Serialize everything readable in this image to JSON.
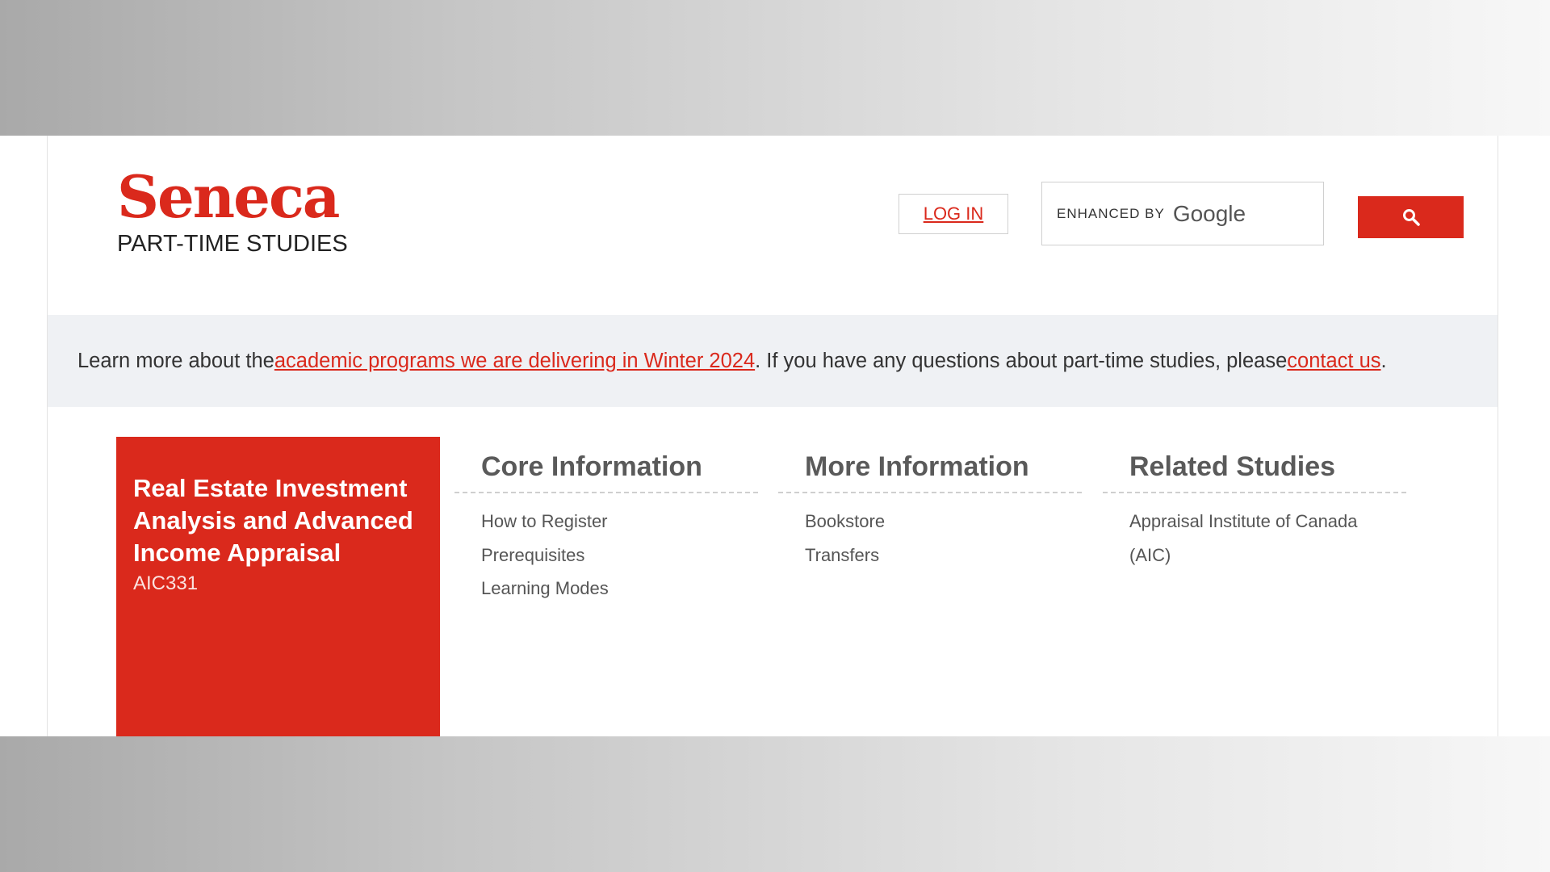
{
  "brand": {
    "name": "Seneca",
    "subtitle": "PART-TIME STUDIES"
  },
  "header": {
    "login_label": "LOG IN",
    "search": {
      "placeholder_small": "ENHANCED BY",
      "placeholder_brand": "Google",
      "button_icon": "search-icon"
    }
  },
  "notice": {
    "prefix": "Learn more about the ",
    "link1": "academic programs we are delivering in Winter 2024",
    "middle": ". If you have any questions about part-time studies, please ",
    "link2": "contact us",
    "suffix": "."
  },
  "course": {
    "title": "Real Estate Investment Analysis and Advanced Income Appraisal",
    "code": "AIC331"
  },
  "columns": [
    {
      "heading": "Core Information",
      "links": [
        "How to Register",
        "Prerequisites",
        "Learning Modes"
      ]
    },
    {
      "heading": "More Information",
      "links": [
        "Bookstore",
        "Transfers"
      ]
    },
    {
      "heading": "Related Studies",
      "links": [
        "Appraisal Institute of Canada",
        "(AIC)"
      ]
    }
  ],
  "colors": {
    "accent": "#da291c",
    "notice_bg": "#eff1f4"
  }
}
